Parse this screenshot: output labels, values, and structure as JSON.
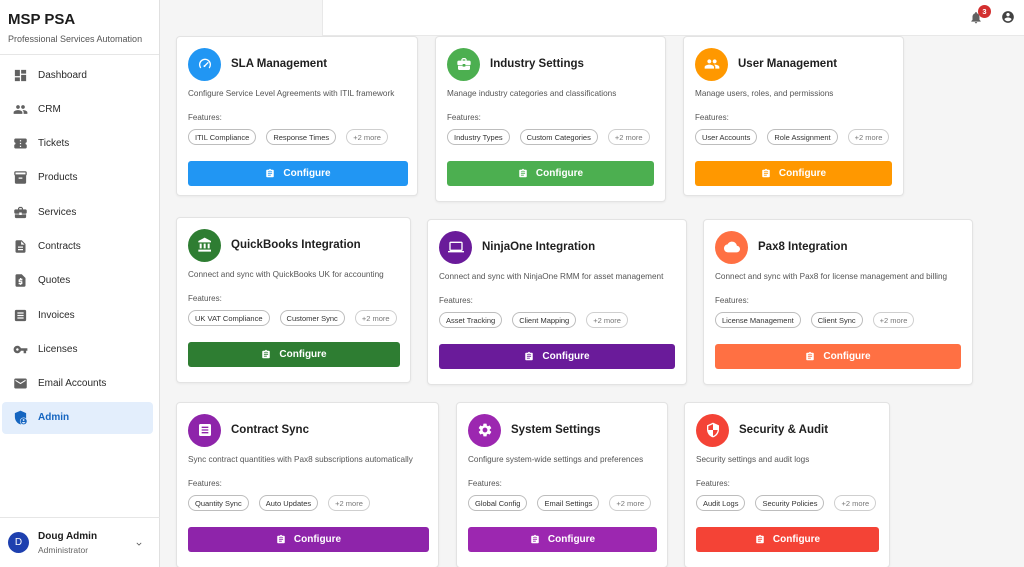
{
  "brand": {
    "title": "MSP PSA",
    "subtitle": "Professional Services Automation"
  },
  "nav": [
    {
      "label": "Dashboard",
      "icon": "dashboard-icon"
    },
    {
      "label": "CRM",
      "icon": "people-icon"
    },
    {
      "label": "Tickets",
      "icon": "ticket-icon"
    },
    {
      "label": "Products",
      "icon": "inventory-icon"
    },
    {
      "label": "Services",
      "icon": "briefcase-icon"
    },
    {
      "label": "Contracts",
      "icon": "document-icon"
    },
    {
      "label": "Quotes",
      "icon": "quote-icon"
    },
    {
      "label": "Invoices",
      "icon": "invoice-icon"
    },
    {
      "label": "Licenses",
      "icon": "key-icon"
    },
    {
      "label": "Email Accounts",
      "icon": "mail-icon"
    },
    {
      "label": "Admin",
      "icon": "admin-shield-icon",
      "active": true
    }
  ],
  "user": {
    "initial": "D",
    "name": "Doug Admin",
    "role": "Administrator"
  },
  "topbar": {
    "notification_count": "3"
  },
  "cards": [
    {
      "title": "SLA Management",
      "description": "Configure Service Level Agreements with ITIL framework",
      "features_label": "Features:",
      "chips": [
        "ITIL Compliance",
        "Response Times",
        "+2 more"
      ],
      "button": "Configure",
      "color": "#2196f3",
      "icon": "speedometer-icon"
    },
    {
      "title": "Industry Settings",
      "description": "Manage industry categories and classifications",
      "features_label": "Features:",
      "chips": [
        "Industry Types",
        "Custom Categories",
        "+2 more"
      ],
      "button": "Configure",
      "color": "#4caf50",
      "icon": "business-case-icon"
    },
    {
      "title": "User Management",
      "description": "Manage users, roles, and permissions",
      "features_label": "Features:",
      "chips": [
        "User Accounts",
        "Role Assignment",
        "+2 more"
      ],
      "button": "Configure",
      "color": "#ff9800",
      "icon": "group-icon"
    },
    {
      "title": "QuickBooks Integration",
      "description": "Connect and sync with QuickBooks UK for accounting",
      "features_label": "Features:",
      "chips": [
        "UK VAT Compliance",
        "Customer Sync",
        "+2 more"
      ],
      "button": "Configure",
      "color": "#2e7d32",
      "icon": "bank-icon"
    },
    {
      "title": "NinjaOne Integration",
      "description": "Connect and sync with NinjaOne RMM for asset management",
      "features_label": "Features:",
      "chips": [
        "Asset Tracking",
        "Client Mapping",
        "+2 more"
      ],
      "button": "Configure",
      "color": "#6a1b9a",
      "icon": "laptop-icon"
    },
    {
      "title": "Pax8 Integration",
      "description": "Connect and sync with Pax8 for license management and billing",
      "features_label": "Features:",
      "chips": [
        "License Management",
        "Client Sync",
        "+2 more"
      ],
      "button": "Configure",
      "color": "#ff7043",
      "icon": "cloud-icon"
    },
    {
      "title": "Contract Sync",
      "description": "Sync contract quantities with Pax8 subscriptions automatically",
      "features_label": "Features:",
      "chips": [
        "Quantity Sync",
        "Auto Updates",
        "+2 more"
      ],
      "button": "Configure",
      "color": "#8e24aa",
      "icon": "list-document-icon"
    },
    {
      "title": "System Settings",
      "description": "Configure system-wide settings and preferences",
      "features_label": "Features:",
      "chips": [
        "Global Config",
        "Email Settings",
        "+2 more"
      ],
      "button": "Configure",
      "color": "#9c27b0",
      "icon": "gear-icon"
    },
    {
      "title": "Security & Audit",
      "description": "Security settings and audit logs",
      "features_label": "Features:",
      "chips": [
        "Audit Logs",
        "Security Policies",
        "+2 more"
      ],
      "button": "Configure",
      "color": "#f44336",
      "icon": "security-shield-icon"
    }
  ]
}
